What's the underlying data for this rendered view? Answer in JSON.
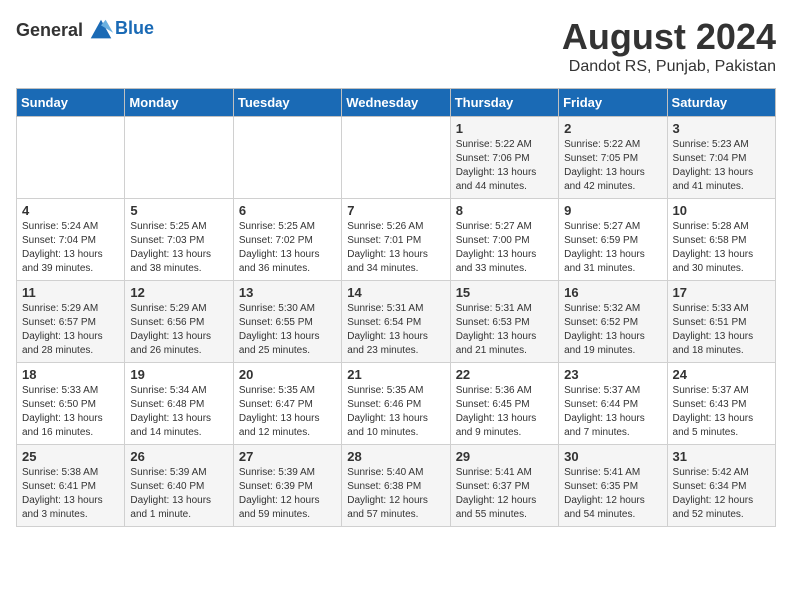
{
  "logo": {
    "general": "General",
    "blue": "Blue"
  },
  "title": "August 2024",
  "location": "Dandot RS, Punjab, Pakistan",
  "days_header": [
    "Sunday",
    "Monday",
    "Tuesday",
    "Wednesday",
    "Thursday",
    "Friday",
    "Saturday"
  ],
  "weeks": [
    [
      {
        "day": "",
        "info": ""
      },
      {
        "day": "",
        "info": ""
      },
      {
        "day": "",
        "info": ""
      },
      {
        "day": "",
        "info": ""
      },
      {
        "day": "1",
        "info": "Sunrise: 5:22 AM\nSunset: 7:06 PM\nDaylight: 13 hours\nand 44 minutes."
      },
      {
        "day": "2",
        "info": "Sunrise: 5:22 AM\nSunset: 7:05 PM\nDaylight: 13 hours\nand 42 minutes."
      },
      {
        "day": "3",
        "info": "Sunrise: 5:23 AM\nSunset: 7:04 PM\nDaylight: 13 hours\nand 41 minutes."
      }
    ],
    [
      {
        "day": "4",
        "info": "Sunrise: 5:24 AM\nSunset: 7:04 PM\nDaylight: 13 hours\nand 39 minutes."
      },
      {
        "day": "5",
        "info": "Sunrise: 5:25 AM\nSunset: 7:03 PM\nDaylight: 13 hours\nand 38 minutes."
      },
      {
        "day": "6",
        "info": "Sunrise: 5:25 AM\nSunset: 7:02 PM\nDaylight: 13 hours\nand 36 minutes."
      },
      {
        "day": "7",
        "info": "Sunrise: 5:26 AM\nSunset: 7:01 PM\nDaylight: 13 hours\nand 34 minutes."
      },
      {
        "day": "8",
        "info": "Sunrise: 5:27 AM\nSunset: 7:00 PM\nDaylight: 13 hours\nand 33 minutes."
      },
      {
        "day": "9",
        "info": "Sunrise: 5:27 AM\nSunset: 6:59 PM\nDaylight: 13 hours\nand 31 minutes."
      },
      {
        "day": "10",
        "info": "Sunrise: 5:28 AM\nSunset: 6:58 PM\nDaylight: 13 hours\nand 30 minutes."
      }
    ],
    [
      {
        "day": "11",
        "info": "Sunrise: 5:29 AM\nSunset: 6:57 PM\nDaylight: 13 hours\nand 28 minutes."
      },
      {
        "day": "12",
        "info": "Sunrise: 5:29 AM\nSunset: 6:56 PM\nDaylight: 13 hours\nand 26 minutes."
      },
      {
        "day": "13",
        "info": "Sunrise: 5:30 AM\nSunset: 6:55 PM\nDaylight: 13 hours\nand 25 minutes."
      },
      {
        "day": "14",
        "info": "Sunrise: 5:31 AM\nSunset: 6:54 PM\nDaylight: 13 hours\nand 23 minutes."
      },
      {
        "day": "15",
        "info": "Sunrise: 5:31 AM\nSunset: 6:53 PM\nDaylight: 13 hours\nand 21 minutes."
      },
      {
        "day": "16",
        "info": "Sunrise: 5:32 AM\nSunset: 6:52 PM\nDaylight: 13 hours\nand 19 minutes."
      },
      {
        "day": "17",
        "info": "Sunrise: 5:33 AM\nSunset: 6:51 PM\nDaylight: 13 hours\nand 18 minutes."
      }
    ],
    [
      {
        "day": "18",
        "info": "Sunrise: 5:33 AM\nSunset: 6:50 PM\nDaylight: 13 hours\nand 16 minutes."
      },
      {
        "day": "19",
        "info": "Sunrise: 5:34 AM\nSunset: 6:48 PM\nDaylight: 13 hours\nand 14 minutes."
      },
      {
        "day": "20",
        "info": "Sunrise: 5:35 AM\nSunset: 6:47 PM\nDaylight: 13 hours\nand 12 minutes."
      },
      {
        "day": "21",
        "info": "Sunrise: 5:35 AM\nSunset: 6:46 PM\nDaylight: 13 hours\nand 10 minutes."
      },
      {
        "day": "22",
        "info": "Sunrise: 5:36 AM\nSunset: 6:45 PM\nDaylight: 13 hours\nand 9 minutes."
      },
      {
        "day": "23",
        "info": "Sunrise: 5:37 AM\nSunset: 6:44 PM\nDaylight: 13 hours\nand 7 minutes."
      },
      {
        "day": "24",
        "info": "Sunrise: 5:37 AM\nSunset: 6:43 PM\nDaylight: 13 hours\nand 5 minutes."
      }
    ],
    [
      {
        "day": "25",
        "info": "Sunrise: 5:38 AM\nSunset: 6:41 PM\nDaylight: 13 hours\nand 3 minutes."
      },
      {
        "day": "26",
        "info": "Sunrise: 5:39 AM\nSunset: 6:40 PM\nDaylight: 13 hours\nand 1 minute."
      },
      {
        "day": "27",
        "info": "Sunrise: 5:39 AM\nSunset: 6:39 PM\nDaylight: 12 hours\nand 59 minutes."
      },
      {
        "day": "28",
        "info": "Sunrise: 5:40 AM\nSunset: 6:38 PM\nDaylight: 12 hours\nand 57 minutes."
      },
      {
        "day": "29",
        "info": "Sunrise: 5:41 AM\nSunset: 6:37 PM\nDaylight: 12 hours\nand 55 minutes."
      },
      {
        "day": "30",
        "info": "Sunrise: 5:41 AM\nSunset: 6:35 PM\nDaylight: 12 hours\nand 54 minutes."
      },
      {
        "day": "31",
        "info": "Sunrise: 5:42 AM\nSunset: 6:34 PM\nDaylight: 12 hours\nand 52 minutes."
      }
    ]
  ]
}
